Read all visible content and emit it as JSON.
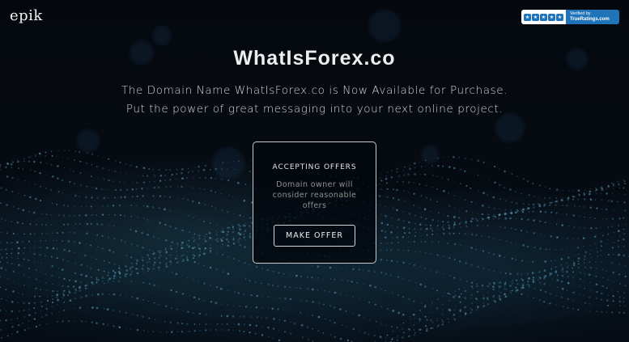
{
  "header": {
    "logo_text": "epik",
    "badge": {
      "line1": "Verified by",
      "line2": "TrueRatings.com",
      "star_count": 5,
      "color": "#1f73b9"
    }
  },
  "main": {
    "domain_title": "WhatIsForex.co",
    "line1": "The Domain Name WhatIsForex.co is Now Available for Purchase.",
    "line2": "Put the power of great messaging into your next online project."
  },
  "offer_card": {
    "heading": "ACCEPTING OFFERS",
    "description": "Domain owner will consider reasonable offers",
    "button_label": "MAKE OFFER"
  },
  "theme": {
    "background": "#03070d",
    "accent": "#1f73b9",
    "wave_color": "#5fa6c8"
  }
}
